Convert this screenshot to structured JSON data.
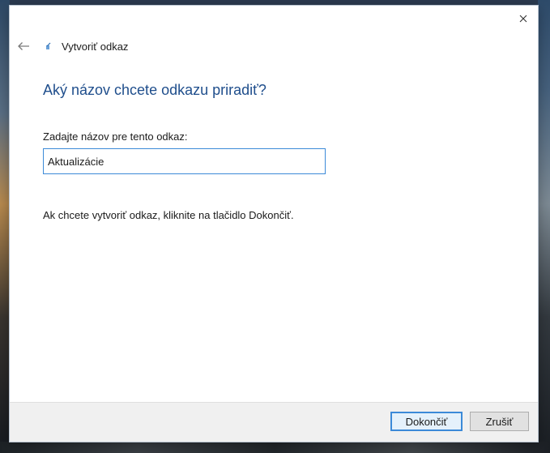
{
  "window": {
    "title": "Vytvoriť odkaz",
    "close_label": "×"
  },
  "page": {
    "heading": "Aký názov chcete odkazu priradiť?",
    "field_label": "Zadajte názov pre tento odkaz:",
    "name_value": "Aktualizácie",
    "info_text": "Ak chcete vytvoriť odkaz, kliknite na tlačidlo Dokončiť."
  },
  "footer": {
    "finish_label": "Dokončiť",
    "cancel_label": "Zrušiť"
  },
  "icons": {
    "back": "back-arrow-icon",
    "shortcut": "shortcut-wizard-icon",
    "close": "close-icon"
  },
  "colors": {
    "heading": "#1f4e8c",
    "input_border": "#3c8ad8",
    "footer_bg": "#f0f0f0"
  }
}
